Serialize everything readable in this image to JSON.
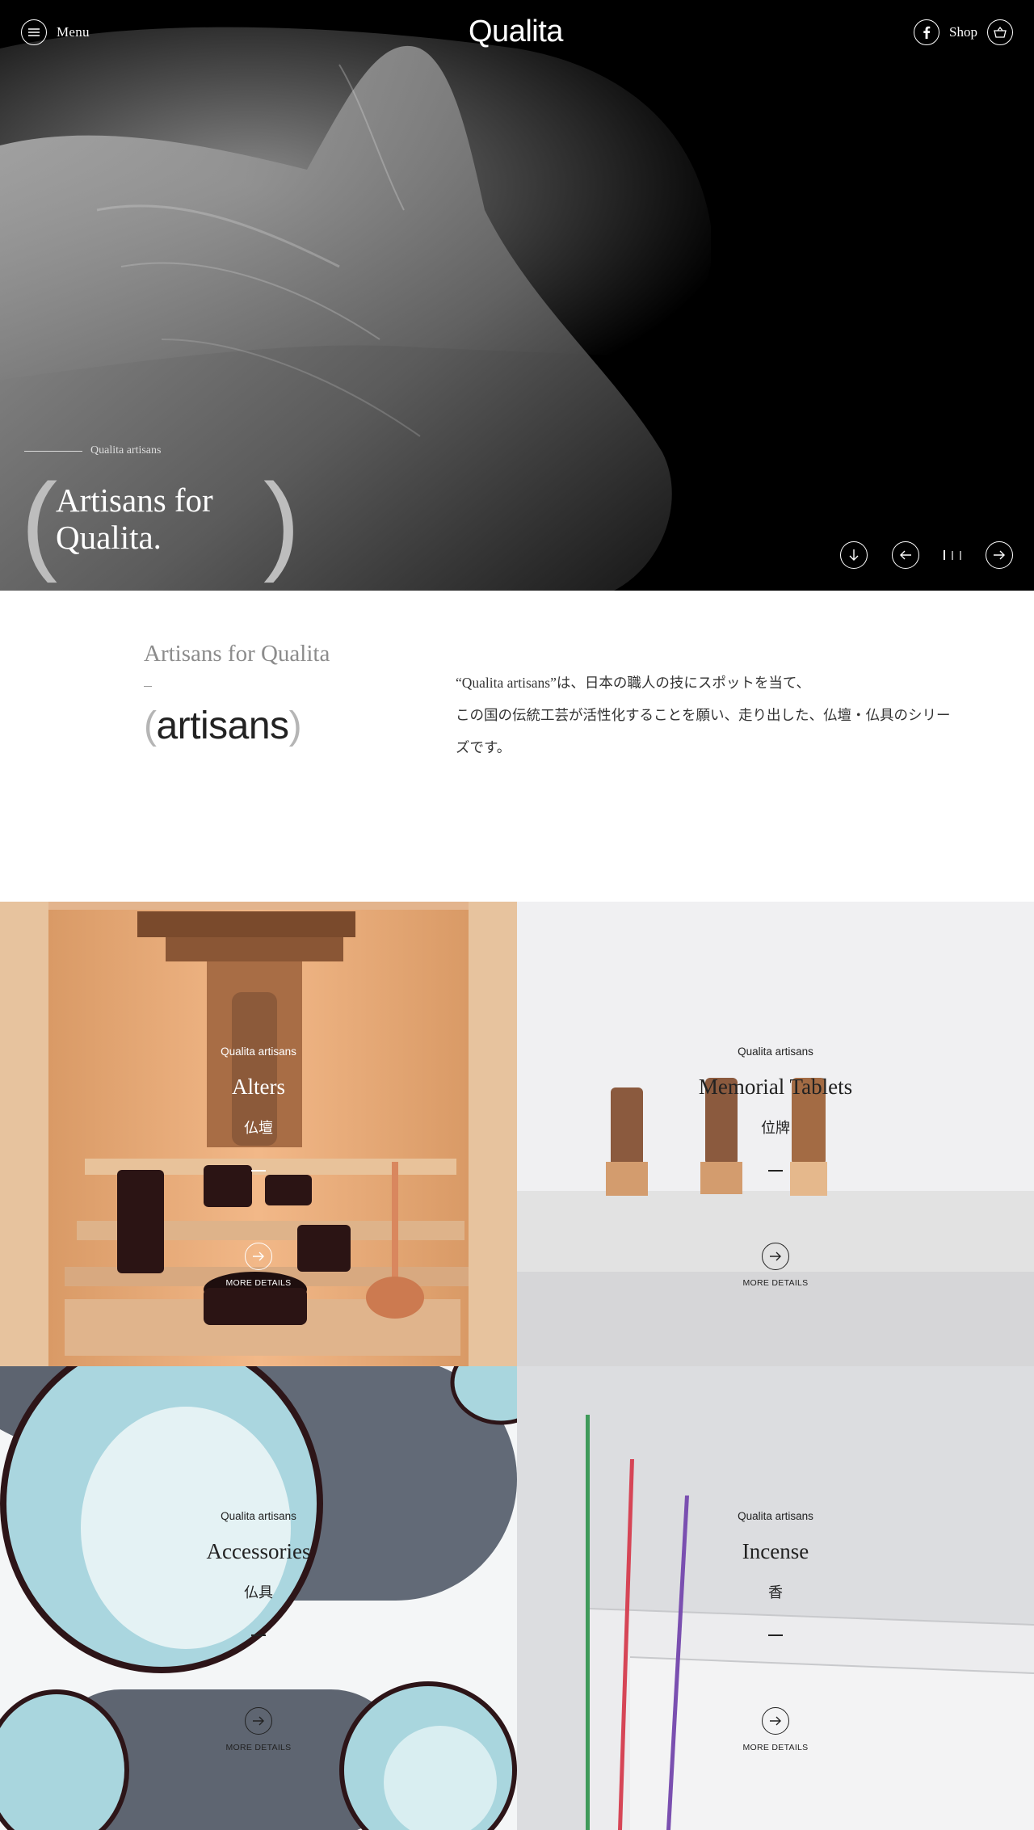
{
  "header": {
    "menu_label": "Menu",
    "logo": "Qualita",
    "shop_label": "Shop",
    "icons": [
      "menu-icon",
      "facebook-icon",
      "basket-icon"
    ]
  },
  "hero": {
    "caption": "Qualita artisans",
    "title_line1": "Artisans for",
    "title_line2": "Qualita.",
    "bracket_open": "(",
    "bracket_close": ")",
    "controls": [
      "arrow-down-icon",
      "arrow-left-icon",
      "arrow-right-icon"
    ],
    "slides": {
      "count": 3,
      "active": 1
    }
  },
  "intro": {
    "kicker": "Artisans for Qualita",
    "dash": "–",
    "word_open": "(",
    "word": "artisans",
    "word_close": ")",
    "text_line1": "“Qualita artisans”は、日本の職人の技にスポットを当て、",
    "text_line2": "この国の伝統工芸が活性化することを願い、走り出した、仏壇・仏具のシリー",
    "text_line3": "ズです。"
  },
  "products": [
    {
      "kicker": "Qualita artisans",
      "title": "Alters",
      "jp": "仏壇",
      "more": "MORE DETAILS"
    },
    {
      "kicker": "Qualita artisans",
      "title": "Memorial Tablets",
      "jp": "位牌",
      "more": "MORE DETAILS"
    },
    {
      "kicker": "Qualita artisans",
      "title": "Accessories",
      "jp": "仏具",
      "more": "MORE DETAILS"
    },
    {
      "kicker": "Qualita artisans",
      "title": "Incense",
      "jp": "香",
      "more": "MORE DETAILS"
    }
  ],
  "colors": {
    "hero_bg": "#000000",
    "wood": "#e6b287",
    "tablet_bg": "#e8e8ea",
    "ceramic_blue": "#a9d6de",
    "incense_bg": "#dfe0e3",
    "incense_green": "#3f9a5a",
    "incense_red": "#d64556",
    "incense_purple": "#7a4fb0"
  }
}
